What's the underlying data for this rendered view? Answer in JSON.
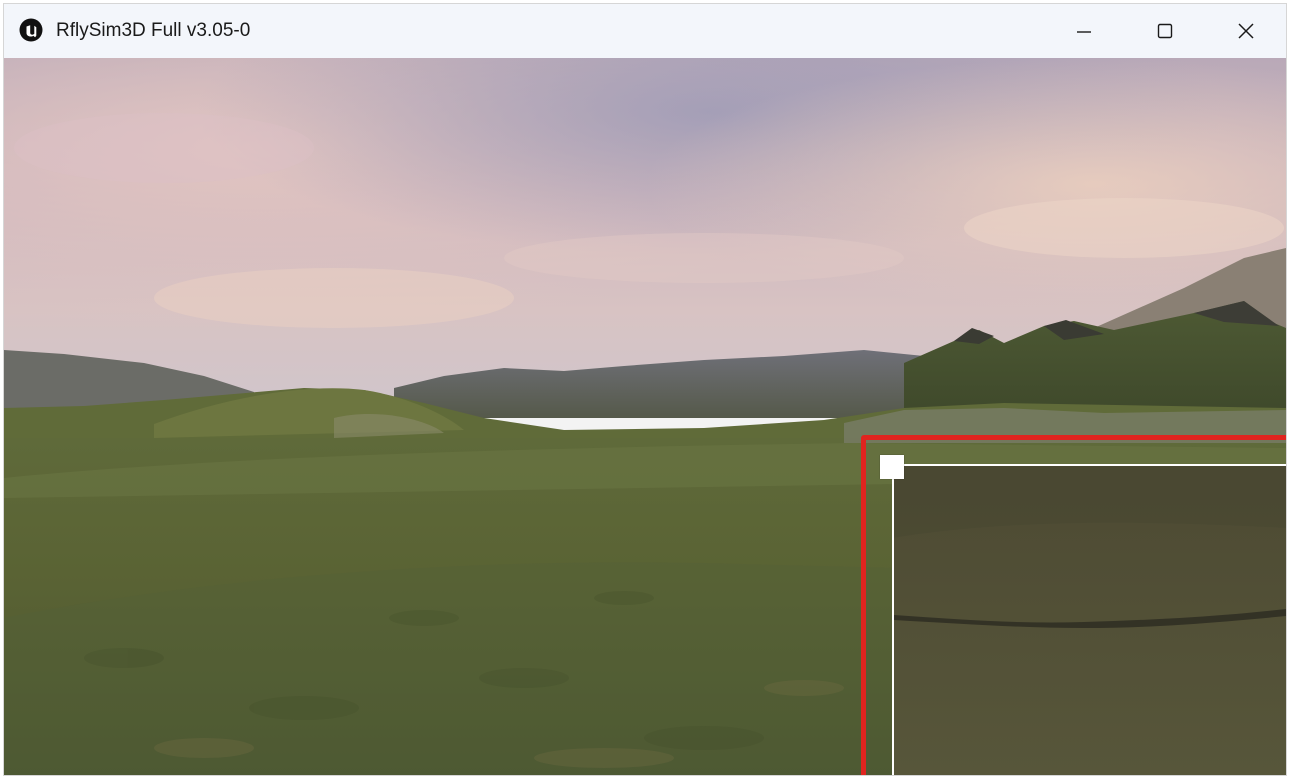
{
  "window": {
    "title": "RflySim3D Full v3.05-0",
    "app_icon": "unreal-engine-logo-icon"
  },
  "caption_buttons": {
    "minimize_icon": "minimize-icon",
    "maximize_icon": "maximize-icon",
    "close_icon": "close-icon"
  },
  "viewport": {
    "scene": "3d-terrain-view",
    "overlay_frame_color": "#e0241f",
    "inset_border_color": "#ffffff"
  }
}
